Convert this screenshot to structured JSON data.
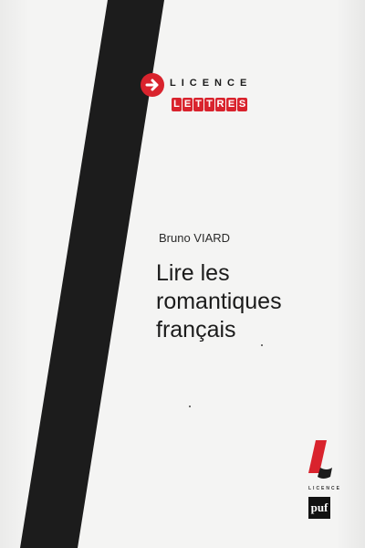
{
  "series": {
    "line1": "LICENCE",
    "line2": "LETTRES",
    "line2_letters": [
      "L",
      "E",
      "T",
      "T",
      "R",
      "E",
      "S"
    ]
  },
  "author": "Bruno VIARD",
  "title_lines": [
    "Lire les",
    "romantiques",
    "français"
  ],
  "collection_label": "LICENCE",
  "publisher": "puf",
  "colors": {
    "accent": "#d9232d",
    "stroke": "#1c1c1c",
    "background": "#f4f4f3"
  },
  "icons": [
    "arrow-right-icon",
    "collection-l-logo",
    "puf-logo"
  ]
}
